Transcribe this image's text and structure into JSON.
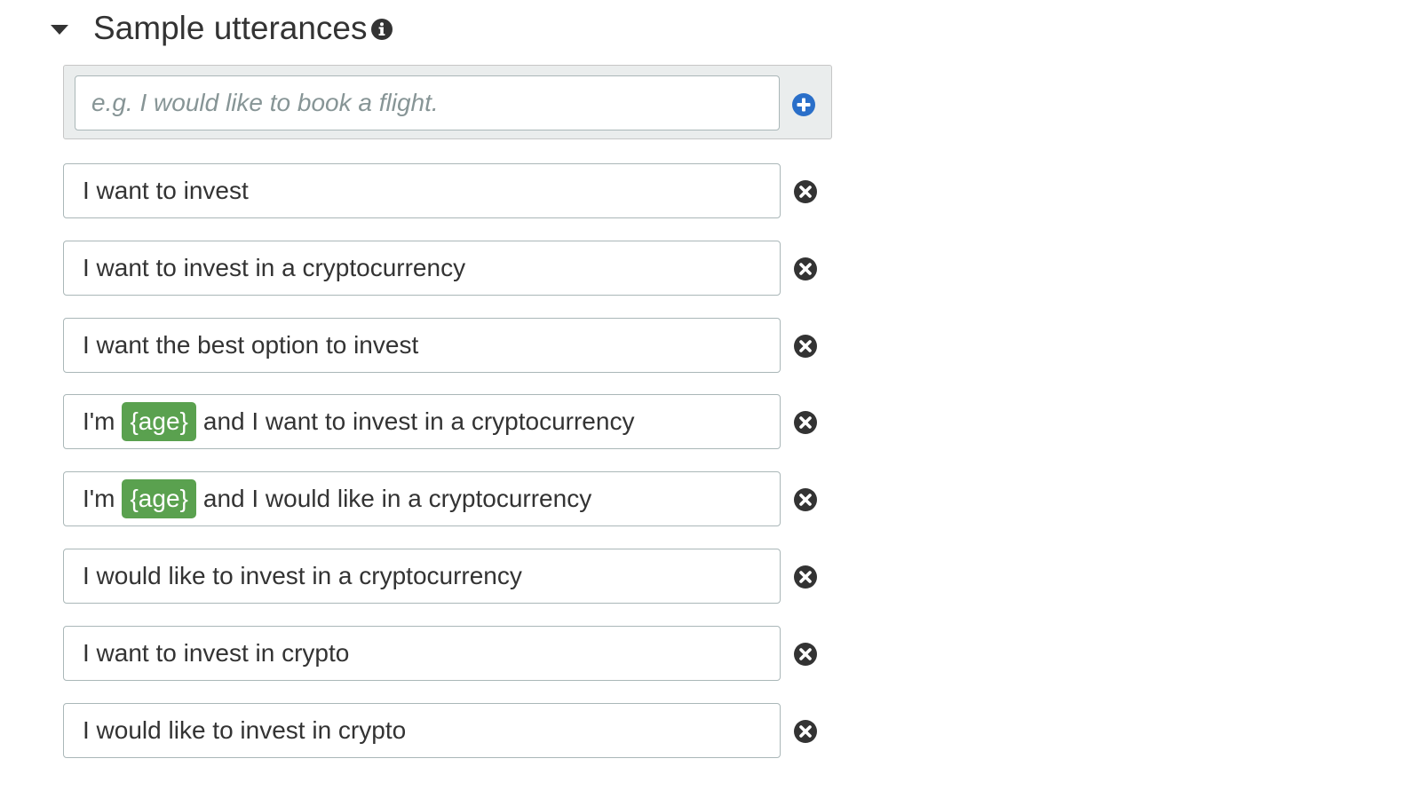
{
  "section": {
    "title": "Sample utterances",
    "expanded": true,
    "icons": {
      "toggle": "caret-down-icon",
      "info": "info-circle-icon"
    }
  },
  "add_utterance": {
    "placeholder": "e.g. I would like to book a flight.",
    "value": "",
    "button_icon": "plus-circle-icon",
    "button_color": "#2a6fc9"
  },
  "slot_color": "#5aa14f",
  "remove_icon": "remove-circle-icon",
  "utterances": [
    {
      "parts": [
        "I want to invest"
      ]
    },
    {
      "parts": [
        "I want to invest in a cryptocurrency"
      ]
    },
    {
      "parts": [
        "I want the best option to invest"
      ]
    },
    {
      "parts": [
        "I'm",
        "{age}",
        "and I want to invest in a cryptocurrency"
      ]
    },
    {
      "parts": [
        "I'm",
        "{age}",
        "and I would like in a cryptocurrency"
      ]
    },
    {
      "parts": [
        "I would like to invest in a cryptocurrency"
      ]
    },
    {
      "parts": [
        "I want to invest in crypto"
      ]
    },
    {
      "parts": [
        "I would like to invest in crypto"
      ]
    }
  ]
}
